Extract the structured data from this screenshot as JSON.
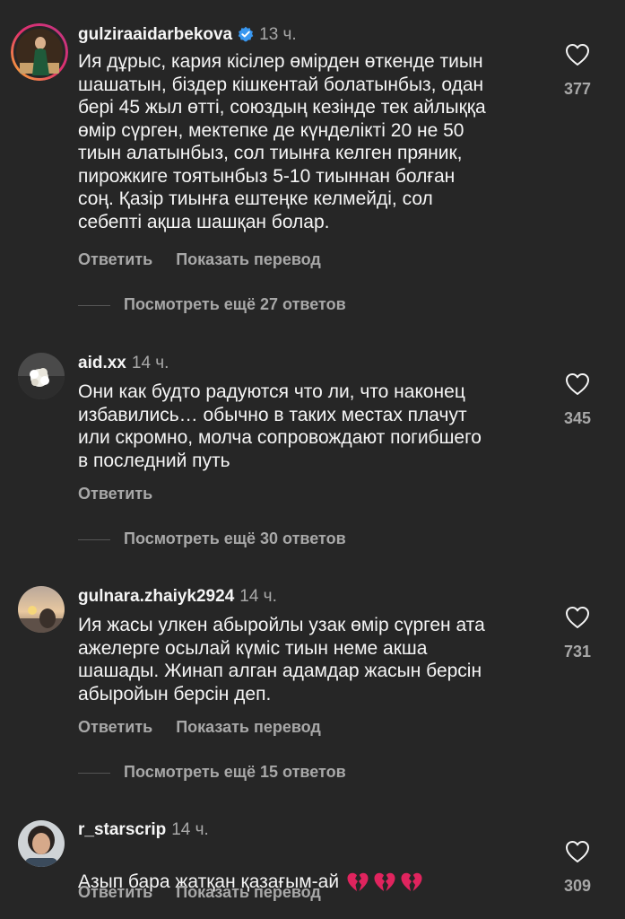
{
  "comments": [
    {
      "username": "gulziraaidarbekova",
      "time": "13 ч.",
      "text": "Ия дұрыс, кария кісілер өмірден өткенде тиын\nшашатын, біздер кішкентай болатынбыз, одан\nбері 45 жыл өтті, союздың кезінде тек айлыққа\nөмір сүрген, мектепке де күнделікті 20 не 50\nтиын алатынбыз, сол тиынға келген пряник,\nпирожкиге тоятынбыз 5-10 тиыннан болған\nсоң. Қазір тиынға ештеңке келмейді, сол\nсебепті ақша шашқан болар.",
      "reply": "Ответить",
      "translate": "Показать перевод",
      "view_replies": "Посмотреть ещё 27 ответов",
      "likes": "377"
    },
    {
      "username": "aid.xx",
      "time": "14 ч.",
      "text": "Они как будто радуются что ли, что наконец\nизбавились… обычно в таких местах плачут\nили скромно, молча сопровождают погибшего\nв последний путь",
      "reply": "Ответить",
      "view_replies": "Посмотреть ещё 30 ответов",
      "likes": "345"
    },
    {
      "username": "gulnara.zhaiyk2924",
      "time": "14 ч.",
      "text": "Ия жасы улкен абыройлы  узак өмір сүрген ата\nажелерге осылай күміс тиын неме акша\nшашады. Жинап алган адамдар жасын берсін\nабыройын берсін деп.",
      "reply": "Ответить",
      "translate": "Показать перевод",
      "view_replies": "Посмотреть ещё 15 ответов",
      "likes": "731"
    },
    {
      "username": "r_starscrip",
      "time": "14 ч.",
      "text": "Азып бара жатқан қазағым-ай",
      "emoji": [
        "broken-heart",
        "broken-heart",
        "broken-heart"
      ],
      "reply": "Ответить",
      "translate": "Показать перевод",
      "likes": "309"
    }
  ],
  "colors": {
    "background": "#262626",
    "primary_text": "#f5f5f5",
    "secondary_text": "#a8a8a8",
    "verified": "#3897f0",
    "heart_emoji": "#e0245e"
  }
}
